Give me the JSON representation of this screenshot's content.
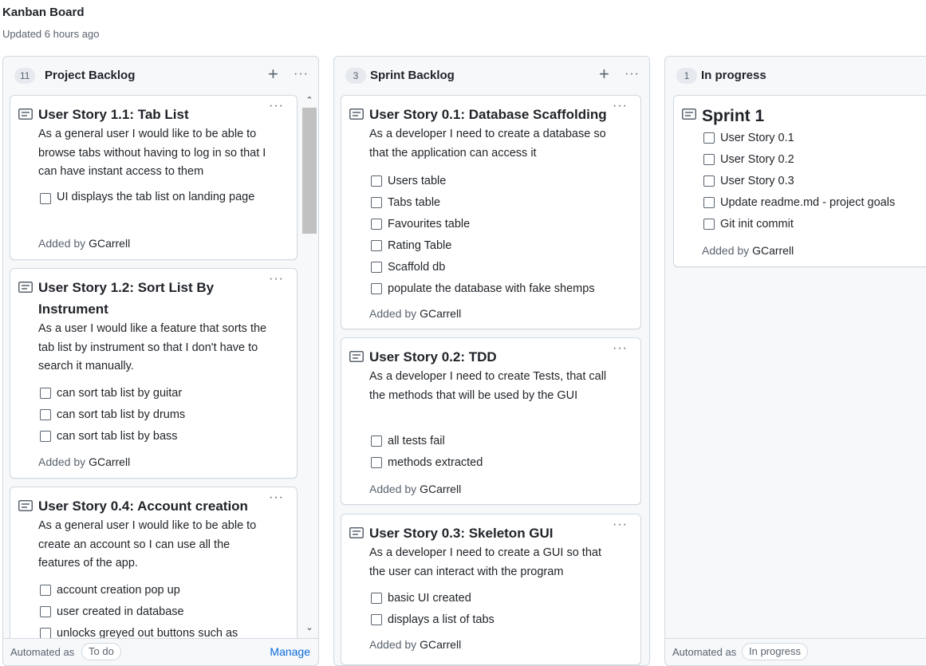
{
  "board": {
    "title": "Kanban Board",
    "updated": "Updated 6 hours ago"
  },
  "columns": [
    {
      "title": "Project Backlog",
      "count": "11",
      "footer": {
        "automated_label": "Automated as",
        "status": "To do",
        "manage": "Manage"
      },
      "cards": [
        {
          "title": "User Story 1.1: Tab List",
          "description": "As a general user I would like to be able to browse tabs without having to log in so that I can have instant access to them",
          "tasks": [
            "UI displays the tab list on landing page"
          ],
          "added_by_label": "Added by",
          "author": "GCarrell"
        },
        {
          "title": "User Story 1.2: Sort List By Instrument",
          "description": "As a user I would like a feature that sorts the tab list by instrument so that I don't have to search it manually.",
          "tasks": [
            "can sort tab list by guitar",
            "can sort tab list by drums",
            "can sort tab list by bass"
          ],
          "added_by_label": "Added by",
          "author": "GCarrell"
        },
        {
          "title": "User Story 0.4: Account creation",
          "description": "As a general user I would like to be able to create an account so I can use all the features of the app.",
          "tasks": [
            "account creation pop up",
            "user created in database",
            "unlocks greyed out buttons such as"
          ],
          "added_by_label": "Added by",
          "author": "GCarrell"
        }
      ]
    },
    {
      "title": "Sprint Backlog",
      "count": "3",
      "cards": [
        {
          "title": "User Story 0.1: Database Scaffolding",
          "description": "As a developer I need to create a database so that the application can access it",
          "tasks": [
            "Users table",
            "Tabs table",
            "Favourites table",
            "Rating Table",
            "Scaffold db",
            "populate the database with fake shemps"
          ],
          "added_by_label": "Added by",
          "author": "GCarrell"
        },
        {
          "title": "User Story 0.2: TDD",
          "description": "As a developer I need to create Tests, that call the methods that will be used by the GUI",
          "tasks": [
            "all tests fail",
            "methods extracted"
          ],
          "added_by_label": "Added by",
          "author": "GCarrell"
        },
        {
          "title": "User Story 0.3: Skeleton GUI",
          "description": "As a developer I need to create a GUI so that the user can interact with the program",
          "tasks": [
            "basic UI created",
            "displays a list of tabs"
          ],
          "added_by_label": "Added by",
          "author": "GCarrell"
        }
      ]
    },
    {
      "title": "In progress",
      "count": "1",
      "footer": {
        "automated_label": "Automated as",
        "status": "In progress"
      },
      "cards": [
        {
          "title": "Sprint 1",
          "tasks": [
            "User Story 0.1",
            "User Story 0.2",
            "User Story 0.3",
            "Update readme.md - project goals",
            "Git init commit"
          ],
          "added_by_label": "Added by",
          "author": "GCarrell"
        }
      ]
    }
  ],
  "icons": {
    "card": "note-icon",
    "add": "plus-icon",
    "more": "kebab-icon",
    "scroll_up": "chevron-up-icon",
    "scroll_down": "chevron-down-icon"
  },
  "colors": {
    "link": "#0969da",
    "border": "#d1d9e0",
    "column_bg": "#f6f8fa",
    "muted": "#59636e"
  }
}
